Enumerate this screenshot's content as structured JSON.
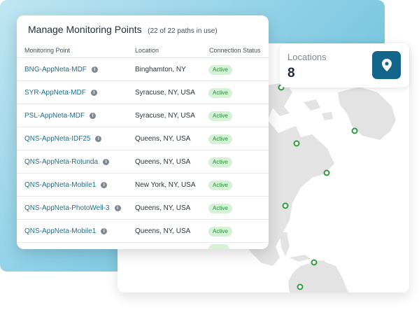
{
  "table": {
    "title": "Manage Monitoring Points",
    "subtitle": "(22 of 22 paths in use)",
    "columns": [
      "Monitoring Point",
      "Location",
      "Connection Status"
    ],
    "rows": [
      {
        "point": "BNG-AppNeta-MDF",
        "location": "Binghamton, NY",
        "status": "Active"
      },
      {
        "point": "SYR-AppNeta-MDF",
        "location": "Syracuse, NY, USA",
        "status": "Active"
      },
      {
        "point": "PSL-AppNeta-MDF",
        "location": "Syracuse, NY, USA",
        "status": "Active"
      },
      {
        "point": "QNS-AppNeta-IDF25",
        "location": "Queens, NY, USA",
        "status": "Active"
      },
      {
        "point": "QNS-AppNeta-Rotunda",
        "location": "Queens, NY, USA",
        "status": "Active"
      },
      {
        "point": "QNS-AppNeta-Mobile1",
        "location": "New York, NY, USA",
        "status": "Active"
      },
      {
        "point": "QNS-AppNeta-PhotoWell-3",
        "location": "Queens, NY, USA",
        "status": "Active"
      },
      {
        "point": "QNS-AppNeta-Mobile1",
        "location": "Queens, NY, USA",
        "status": "Active"
      }
    ]
  },
  "locations": {
    "title": "Locations",
    "count": "8",
    "button_icon": "map-pin-icon"
  },
  "colors": {
    "accent": "#13658a",
    "link": "#1f6f92",
    "badge_bg": "#d5f2d7",
    "badge_text": "#2b8a3a",
    "map_land": "#e3e3e3",
    "marker": "#2e9e3e"
  }
}
